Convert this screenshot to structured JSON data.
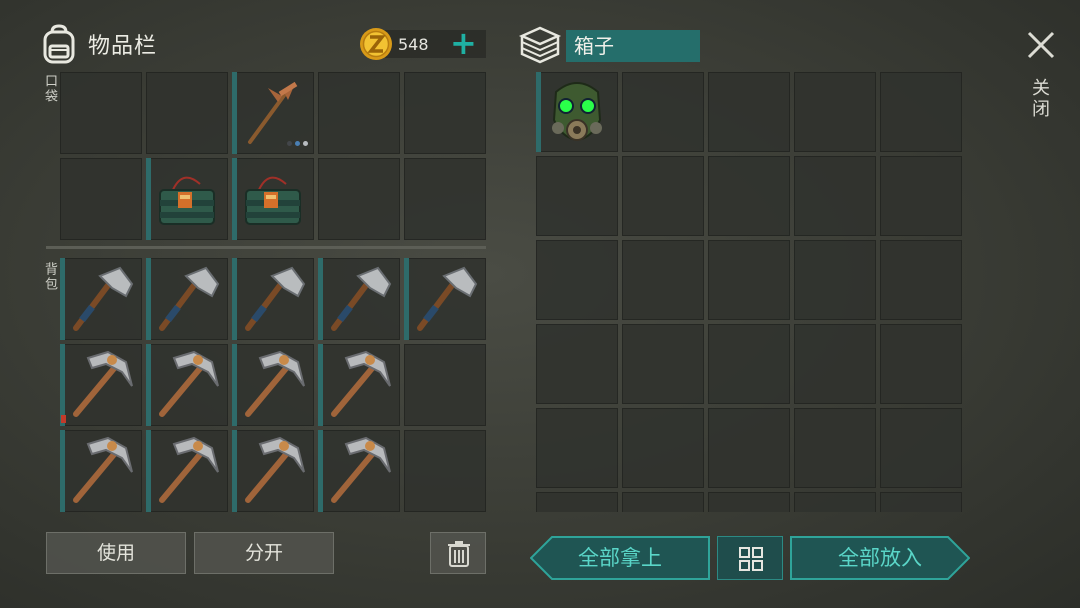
{
  "inventory": {
    "title": "物品栏",
    "gold": "548",
    "pockets_label": "口袋",
    "backpack_label": "背包"
  },
  "box": {
    "title": "箱子"
  },
  "close_label": "关闭",
  "buttons": {
    "use": "使用",
    "split": "分开",
    "take_all": "全部拿上",
    "put_all": "全部放入"
  },
  "colors": {
    "accent": "#1fb0a3",
    "slot_bg": "#30322e",
    "durability_bar": "#2e6b6a",
    "low_durability": "#c23a2a"
  },
  "pockets": [
    {
      "item": "empty"
    },
    {
      "item": "empty"
    },
    {
      "item": "primitive-pickaxe",
      "variants": 3
    },
    {
      "item": "empty"
    },
    {
      "item": "empty"
    },
    {
      "item": "empty"
    },
    {
      "item": "explosive-charge"
    },
    {
      "item": "explosive-charge"
    },
    {
      "item": "empty"
    },
    {
      "item": "empty"
    }
  ],
  "backpack": [
    {
      "item": "iron-hatchet"
    },
    {
      "item": "iron-hatchet"
    },
    {
      "item": "iron-hatchet"
    },
    {
      "item": "iron-hatchet"
    },
    {
      "item": "iron-hatchet"
    },
    {
      "item": "stone-pickaxe",
      "durability": "low"
    },
    {
      "item": "stone-pickaxe"
    },
    {
      "item": "stone-pickaxe"
    },
    {
      "item": "stone-pickaxe"
    },
    {
      "item": "empty"
    },
    {
      "item": "stone-pickaxe"
    },
    {
      "item": "stone-pickaxe"
    },
    {
      "item": "stone-pickaxe"
    },
    {
      "item": "stone-pickaxe"
    },
    {
      "item": "empty"
    }
  ],
  "box_slots": [
    {
      "item": "gas-mask"
    },
    {
      "item": "empty"
    },
    {
      "item": "empty"
    },
    {
      "item": "empty"
    },
    {
      "item": "empty"
    }
  ],
  "box_rows_visible": 6,
  "icons": [
    "backpack-icon",
    "gold-coin-icon",
    "plus-icon",
    "box-icon",
    "close-icon",
    "trash-icon",
    "grid-icon"
  ]
}
